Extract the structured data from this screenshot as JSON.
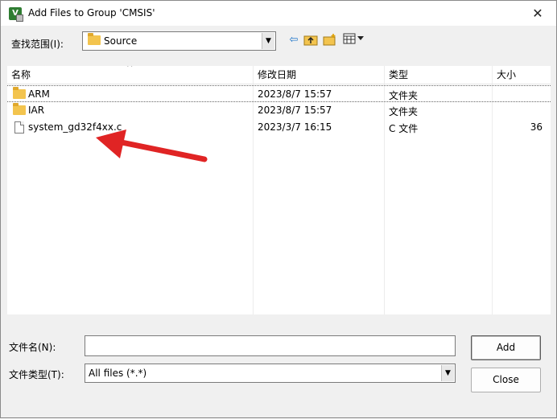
{
  "window": {
    "title": "Add Files to Group 'CMSIS'",
    "app_icon_glyph": "V",
    "close_glyph": "✕"
  },
  "lookin": {
    "label": "查找范围(I):",
    "value": "Source",
    "icons": [
      "back-icon",
      "up-folder-icon",
      "new-folder-icon",
      "view-menu-icon"
    ]
  },
  "list": {
    "columns": [
      "名称",
      "修改日期",
      "类型",
      "大小"
    ],
    "rows": [
      {
        "name": "ARM",
        "date": "2023/8/7 15:57",
        "type": "文件夹",
        "size": "",
        "icon": "folder-icon"
      },
      {
        "name": "IAR",
        "date": "2023/8/7 15:57",
        "type": "文件夹",
        "size": "",
        "icon": "folder-icon"
      },
      {
        "name": "system_gd32f4xx.c",
        "date": "2023/3/7 16:15",
        "type": "C 文件",
        "size": "36",
        "icon": "file-icon"
      }
    ]
  },
  "filename": {
    "label": "文件名(N):",
    "value": ""
  },
  "filetype": {
    "label": "文件类型(T):",
    "value": "All files (*.*)"
  },
  "buttons": {
    "add": "Add",
    "close": "Close"
  },
  "colors": {
    "annotation_arrow": "#e02424",
    "folder": "#f3c44e"
  }
}
